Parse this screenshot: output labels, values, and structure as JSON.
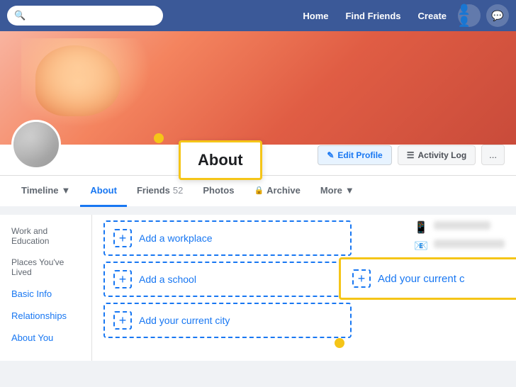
{
  "nav": {
    "links": [
      "Home",
      "Find Friends",
      "Create"
    ],
    "search_placeholder": "Search",
    "icons": [
      "people-icon",
      "messenger-icon"
    ]
  },
  "profile": {
    "edit_profile_label": "Edit Profile",
    "activity_log_label": "Activity Log",
    "more_options_label": "...",
    "tabs": [
      {
        "label": "Timeline",
        "active": false,
        "dropdown": true
      },
      {
        "label": "About",
        "active": true
      },
      {
        "label": "Friends",
        "active": false,
        "count": "52"
      },
      {
        "label": "Photos",
        "active": false
      },
      {
        "label": "Archive",
        "active": false,
        "locked": true
      },
      {
        "label": "More",
        "active": false,
        "dropdown": true
      }
    ]
  },
  "about_tooltip": {
    "label": "About"
  },
  "sidebar": {
    "items": [
      {
        "label": "Work and Education",
        "type": "section"
      },
      {
        "label": "Places You've Lived",
        "type": "section"
      },
      {
        "label": "Basic Info",
        "type": "link"
      },
      {
        "label": "Relationships",
        "type": "link"
      },
      {
        "label": "About You",
        "type": "link"
      }
    ]
  },
  "content": {
    "add_workplace_label": "Add a workplace",
    "add_school_label": "Add a school",
    "add_city_label": "Add your current city",
    "add_current_city_panel_label": "Add your current c"
  }
}
